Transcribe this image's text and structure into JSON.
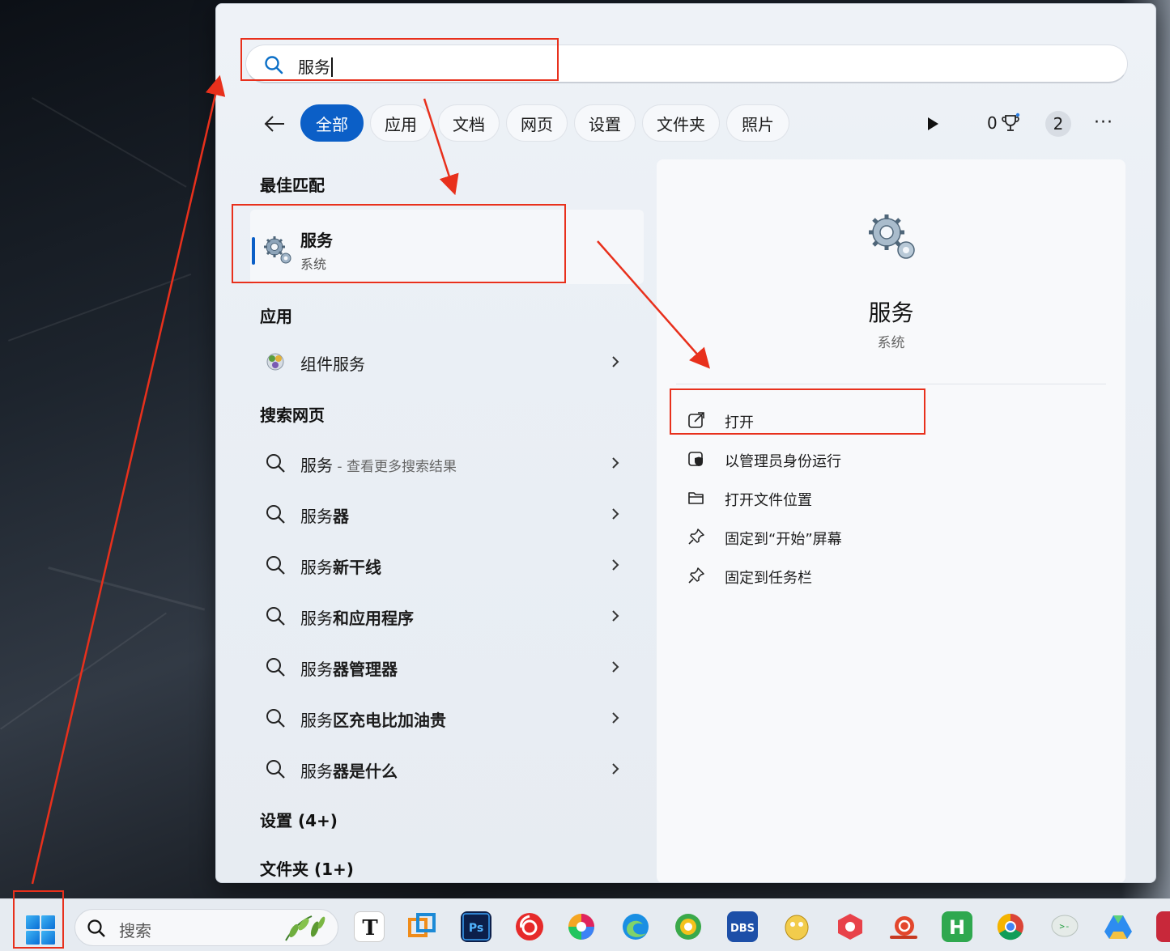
{
  "search": {
    "query": "服务"
  },
  "filters": {
    "tabs": [
      {
        "label": "全部",
        "active": true
      },
      {
        "label": "应用",
        "active": false
      },
      {
        "label": "文档",
        "active": false
      },
      {
        "label": "网页",
        "active": false
      },
      {
        "label": "设置",
        "active": false
      },
      {
        "label": "文件夹",
        "active": false
      },
      {
        "label": "照片",
        "active": false
      }
    ],
    "points": "0",
    "badge": "2",
    "more": "···"
  },
  "results": {
    "best_match_header": "最佳匹配",
    "best_match": {
      "title": "服务",
      "subtitle": "系统"
    },
    "apps_header": "应用",
    "apps": [
      {
        "label": "组件服务"
      }
    ],
    "web_header": "搜索网页",
    "web": [
      {
        "prefix": "服务",
        "hint": " - 查看更多搜索结果",
        "rest": ""
      },
      {
        "prefix": "服务",
        "hint": "",
        "rest": "器"
      },
      {
        "prefix": "服务",
        "hint": "",
        "rest": "新干线"
      },
      {
        "prefix": "服务",
        "hint": "",
        "rest": "和应用程序"
      },
      {
        "prefix": "服务",
        "hint": "",
        "rest": "器管理器"
      },
      {
        "prefix": "服务",
        "hint": "",
        "rest": "区充电比加油贵"
      },
      {
        "prefix": "服务",
        "hint": "",
        "rest": "器是什么"
      }
    ],
    "settings_header": "设置 (4+)",
    "folders_header": "文件夹 (1+)"
  },
  "detail": {
    "title": "服务",
    "subtitle": "系统",
    "actions": [
      {
        "label": "打开",
        "icon": "open-external-icon"
      },
      {
        "label": "以管理员身份运行",
        "icon": "shield-icon"
      },
      {
        "label": "打开文件位置",
        "icon": "folder-icon"
      },
      {
        "label": "固定到“开始”屏幕",
        "icon": "pin-icon"
      },
      {
        "label": "固定到任务栏",
        "icon": "pin-icon"
      }
    ]
  },
  "taskbar": {
    "search_placeholder": "搜索",
    "apps": [
      "typora",
      "vmware",
      "photoshop",
      "netease-music",
      "color-app",
      "edge",
      "browser-360",
      "dbs-tool",
      "navicat",
      "app-red",
      "app-snail",
      "hbuilder",
      "chrome",
      "wechat-dev",
      "drive",
      "app-more"
    ]
  },
  "colors": {
    "accent": "#0b5fc7",
    "annotation": "#e8301c"
  }
}
